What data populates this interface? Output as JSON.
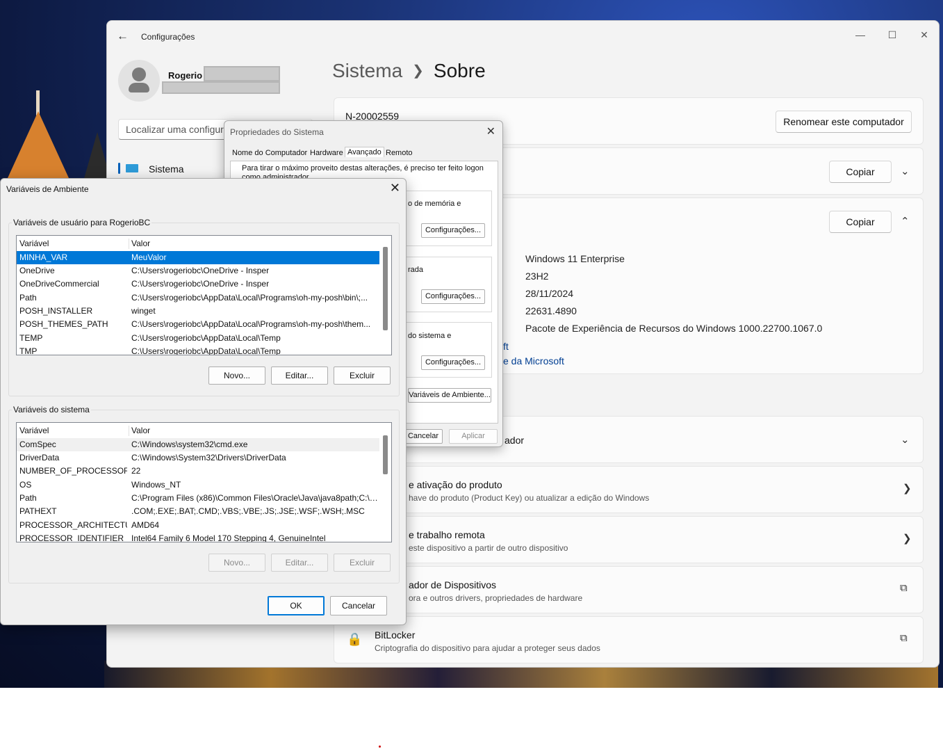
{
  "settings": {
    "app_title": "Configurações",
    "user_name": "Rogerio",
    "search_placeholder": "Localizar uma configuração",
    "nav_active": "Sistema",
    "breadcrumb_parent": "Sistema",
    "breadcrumb_current": "Sobre",
    "computer_name": "N-20002559",
    "rename_button": "Renomear este computador",
    "copy_button": "Copiar",
    "windows_specs": [
      "Windows 11 Enterprise",
      "23H2",
      "28/11/2024",
      "22631.4890",
      "Pacote de Experiência de Recursos do Windows 1000.22700.1067.0"
    ],
    "link_partial_1": "ft",
    "link_partial_2": "e da Microsoft",
    "rows": [
      {
        "title": "ador",
        "subtitle": ""
      },
      {
        "title": "e ativação do produto",
        "subtitle": "have do produto (Product Key) ou atualizar a edição do Windows"
      },
      {
        "title": "e trabalho remota",
        "subtitle": "este dispositivo a partir de outro dispositivo"
      },
      {
        "title": "ador de Dispositivos",
        "subtitle": "ora e outros drivers, propriedades de hardware"
      },
      {
        "title": "BitLocker",
        "subtitle": "Criptografia do dispositivo para ajudar a proteger seus dados"
      }
    ],
    "accent_color": "#005fb8"
  },
  "sysprops": {
    "title": "Propriedades do Sistema",
    "tabs": [
      "Nome do Computador",
      "Hardware",
      "Avançado",
      "Remoto"
    ],
    "active_tab": "Avançado",
    "note": "Para tirar o máximo proveito destas alterações, é preciso ter feito logon como administrador.",
    "group1_text": "o de memória e",
    "group2_text": "rada",
    "group3_text": "do sistema e",
    "settings_button": "Configurações...",
    "envvars_button": "Variáveis de Ambiente...",
    "cancel_button": "Cancelar",
    "apply_button": "Aplicar"
  },
  "envvars": {
    "title": "Variáveis de Ambiente",
    "user_section": "Variáveis de usuário para RogerioBC",
    "system_section": "Variáveis do sistema",
    "col_var": "Variável",
    "col_value": "Valor",
    "user_vars": [
      {
        "name": "MINHA_VAR",
        "value": "MeuValor"
      },
      {
        "name": "OneDrive",
        "value": "C:\\Users\\rogeriobc\\OneDrive - Insper"
      },
      {
        "name": "OneDriveCommercial",
        "value": "C:\\Users\\rogeriobc\\OneDrive - Insper"
      },
      {
        "name": "Path",
        "value": "C:\\Users\\rogeriobc\\AppData\\Local\\Programs\\oh-my-posh\\bin\\;..."
      },
      {
        "name": "POSH_INSTALLER",
        "value": "winget"
      },
      {
        "name": "POSH_THEMES_PATH",
        "value": "C:\\Users\\rogeriobc\\AppData\\Local\\Programs\\oh-my-posh\\them..."
      },
      {
        "name": "TEMP",
        "value": "C:\\Users\\rogeriobc\\AppData\\Local\\Temp"
      },
      {
        "name": "TMP",
        "value": "C:\\Users\\rogeriobc\\AppData\\Local\\Temp"
      }
    ],
    "system_vars": [
      {
        "name": "ComSpec",
        "value": "C:\\Windows\\system32\\cmd.exe"
      },
      {
        "name": "DriverData",
        "value": "C:\\Windows\\System32\\Drivers\\DriverData"
      },
      {
        "name": "NUMBER_OF_PROCESSORS",
        "value": "22"
      },
      {
        "name": "OS",
        "value": "Windows_NT"
      },
      {
        "name": "Path",
        "value": "C:\\Program Files (x86)\\Common Files\\Oracle\\Java\\java8path;C:\\P..."
      },
      {
        "name": "PATHEXT",
        "value": ".COM;.EXE;.BAT;.CMD;.VBS;.VBE;.JS;.JSE;.WSF;.WSH;.MSC"
      },
      {
        "name": "PROCESSOR_ARCHITECTURE",
        "value": "AMD64"
      },
      {
        "name": "PROCESSOR_IDENTIFIER",
        "value": "Intel64 Family 6 Model 170 Stepping 4, GenuineIntel"
      }
    ],
    "new_button": "Novo...",
    "edit_button": "Editar...",
    "delete_button": "Excluir",
    "ok_button": "OK",
    "cancel_button": "Cancelar",
    "selection_color": "#0078d7"
  }
}
